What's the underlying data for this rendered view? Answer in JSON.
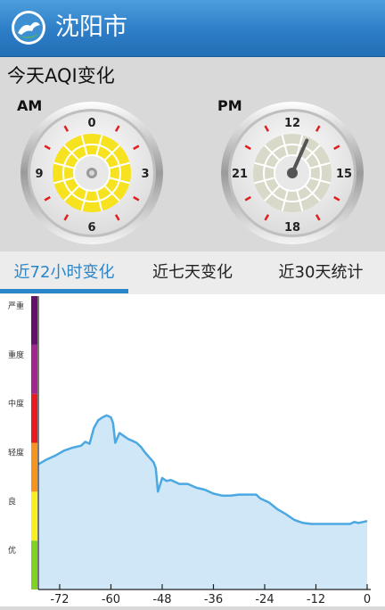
{
  "header": {
    "city": "沈阳市",
    "logo_icon": "green-leaf-blue-circle-logo"
  },
  "subtitle": "今天AQI变化",
  "gauges": {
    "am": {
      "label": "AM",
      "ticks": [
        "0",
        "3",
        "6",
        "9"
      ],
      "hand_hour": 0,
      "fill_color": "#f6e21e"
    },
    "pm": {
      "label": "PM",
      "ticks": [
        "12",
        "15",
        "18",
        "21"
      ],
      "hand_hour": 12.8,
      "fill_color": "#d9d9c9"
    }
  },
  "tabs": [
    {
      "label": "近72小时变化",
      "active": true
    },
    {
      "label": "近七天变化",
      "active": false
    },
    {
      "label": "近30天统计",
      "active": false
    }
  ],
  "chart_data": {
    "type": "area",
    "title": "",
    "xlabel": "",
    "ylabel": "",
    "x_ticks": [
      "-72",
      "-60",
      "-48",
      "-36",
      "-24",
      "-12",
      "0"
    ],
    "xlim": [
      -77,
      0
    ],
    "ylim": [
      0,
      300
    ],
    "levels": [
      {
        "label": "优",
        "color": "#7ed321",
        "range": [
          0,
          50
        ]
      },
      {
        "label": "良",
        "color": "#f8f01c",
        "range": [
          50,
          100
        ]
      },
      {
        "label": "轻度",
        "color": "#f7941d",
        "range": [
          100,
          150
        ]
      },
      {
        "label": "中度",
        "color": "#e8191f",
        "range": [
          150,
          200
        ]
      },
      {
        "label": "重度",
        "color": "#a3258e",
        "range": [
          200,
          250
        ]
      },
      {
        "label": "严重",
        "color": "#63126a",
        "range": [
          250,
          300
        ]
      }
    ],
    "series": [
      {
        "color": "#4ca8e0",
        "fill": "#cfe7f7",
        "points": [
          [
            -77,
            128
          ],
          [
            -75,
            133
          ],
          [
            -73,
            137
          ],
          [
            -71,
            142
          ],
          [
            -69,
            145
          ],
          [
            -67,
            147
          ],
          [
            -66,
            151
          ],
          [
            -65,
            149
          ],
          [
            -64,
            165
          ],
          [
            -63,
            173
          ],
          [
            -62,
            176
          ],
          [
            -61,
            178
          ],
          [
            -60,
            176
          ],
          [
            -59.5,
            170
          ],
          [
            -59,
            150
          ],
          [
            -58,
            160
          ],
          [
            -57,
            157
          ],
          [
            -56,
            154
          ],
          [
            -55,
            152
          ],
          [
            -54,
            150
          ],
          [
            -53,
            146
          ],
          [
            -52,
            140
          ],
          [
            -51,
            135
          ],
          [
            -50,
            130
          ],
          [
            -49.5,
            124
          ],
          [
            -49,
            100
          ],
          [
            -48,
            114
          ],
          [
            -47,
            111
          ],
          [
            -46,
            112
          ],
          [
            -45,
            110
          ],
          [
            -44,
            108
          ],
          [
            -42,
            108
          ],
          [
            -40,
            104
          ],
          [
            -38,
            102
          ],
          [
            -36,
            98
          ],
          [
            -34,
            96
          ],
          [
            -32,
            96
          ],
          [
            -30,
            97
          ],
          [
            -26,
            97
          ],
          [
            -25,
            93
          ],
          [
            -23,
            89
          ],
          [
            -21,
            82
          ],
          [
            -19,
            77
          ],
          [
            -17,
            71
          ],
          [
            -15,
            68
          ],
          [
            -13,
            67
          ],
          [
            -11,
            67
          ],
          [
            -9,
            67
          ],
          [
            -5,
            67
          ],
          [
            -4,
            67
          ],
          [
            -3,
            69
          ],
          [
            -2,
            68
          ],
          [
            -1,
            69
          ],
          [
            0,
            70
          ]
        ]
      }
    ]
  },
  "colors": {
    "accent": "#2a86c9",
    "header": "#2d7dc7"
  }
}
